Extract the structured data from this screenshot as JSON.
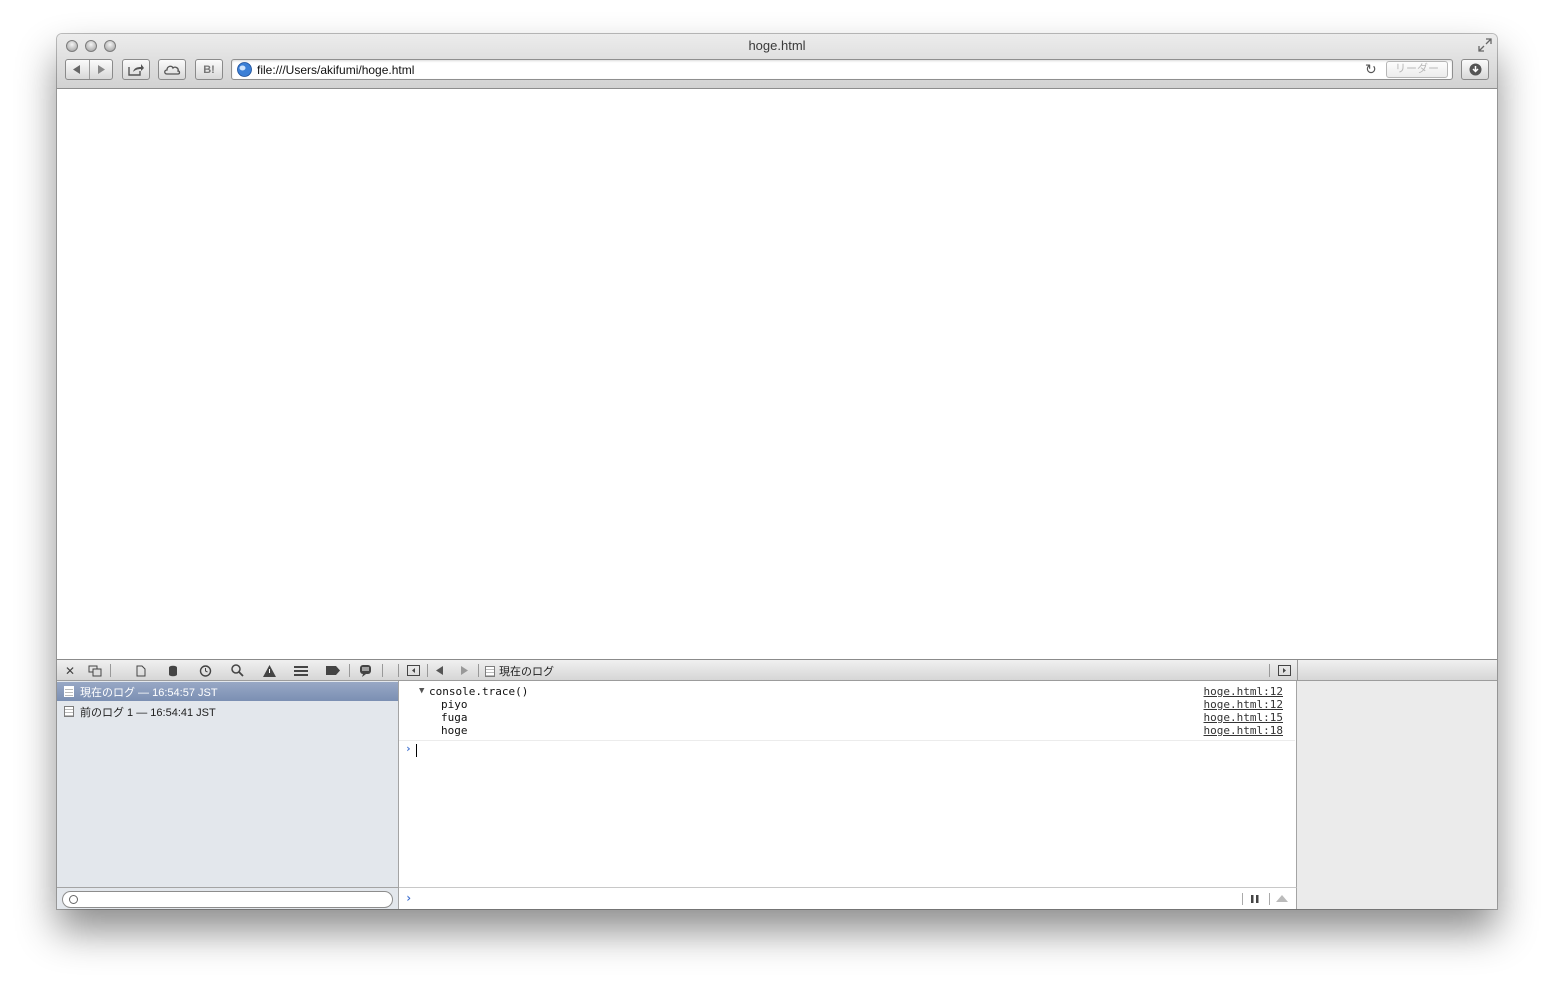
{
  "window": {
    "title": "hoge.html"
  },
  "toolbar": {
    "back_icon": "back-arrow-icon",
    "forward_icon": "forward-arrow-icon",
    "share_icon": "share-icon",
    "cloud_icon": "icloud-icon",
    "hatena_label": "B!",
    "url": "file:///Users/akifumi/hoge.html",
    "reader_label": "リーダー",
    "download_icon": "downloads-icon"
  },
  "inspector": {
    "toolbar": {
      "breadcrumb_label": "現在のログ"
    },
    "logs": [
      {
        "label": "現在のログ — 16:54:57 JST",
        "selected": true
      },
      {
        "label": "前のログ 1 — 16:54:41 JST",
        "selected": false
      }
    ],
    "console": {
      "trace_header": "console.trace()",
      "entries": [
        {
          "text": "console.trace()",
          "link": "hoge.html:12"
        },
        {
          "text": "piyo",
          "link": "hoge.html:12"
        },
        {
          "text": "fuga",
          "link": "hoge.html:15"
        },
        {
          "text": "hoge",
          "link": "hoge.html:18"
        }
      ],
      "prompt": "›"
    },
    "colors": {
      "accent": "#3d6fd0",
      "selection": "#8a9cbd",
      "sidebar": "#e3e7ec"
    }
  }
}
